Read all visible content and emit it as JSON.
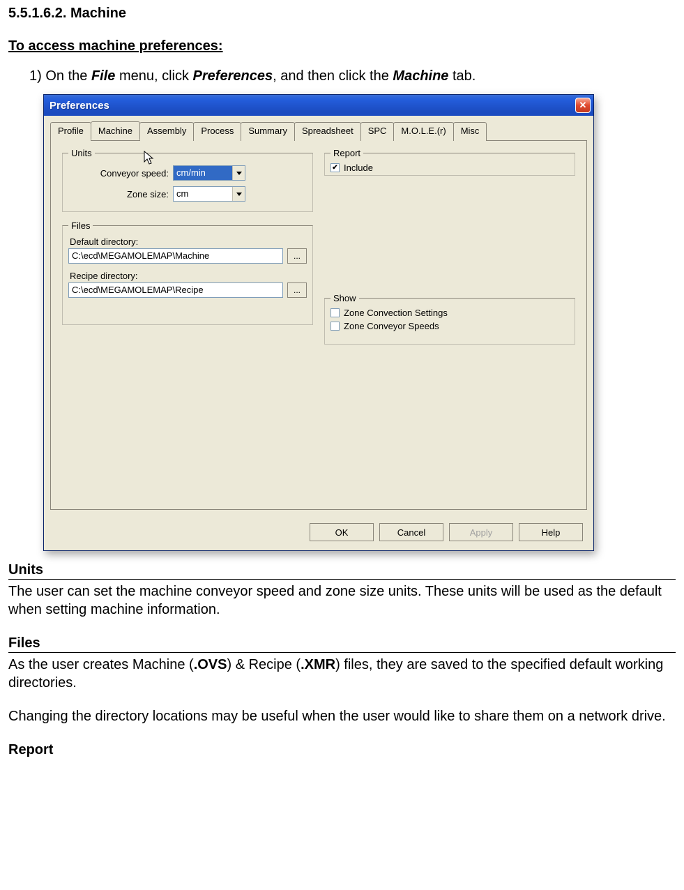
{
  "doc": {
    "section_number": "5.5.1.6.2. Machine",
    "access_heading": "To access machine preferences:",
    "step1_prefix": "1) On the ",
    "step1_kw_file": "File",
    "step1_mid1": " menu, click ",
    "step1_kw_prefs": "Preferences",
    "step1_mid2": ", and then click the ",
    "step1_kw_machine": "Machine",
    "step1_suffix": " tab.",
    "sections": {
      "units_head": "Units",
      "units_para": "The user can set the machine conveyor speed and zone size units. These units will be used as the default when setting machine information.",
      "files_head": "Files",
      "files_para1_a": "As the user creates Machine (",
      "files_para1_ovs": ".OVS",
      "files_para1_b": ") & Recipe (",
      "files_para1_xmr": ".XMR",
      "files_para1_c": ") files, they are saved to the specified default working directories.",
      "files_para2": "Changing the directory locations may be useful when the user would like to share them on a network drive.",
      "report_head": "Report"
    }
  },
  "dialog": {
    "title": "Preferences",
    "tabs": [
      "Profile",
      "Machine",
      "Assembly",
      "Process",
      "Summary",
      "Spreadsheet",
      "SPC",
      "M.O.L.E.(r)",
      "Misc"
    ],
    "active_tab_index": 1,
    "units": {
      "legend": "Units",
      "conveyor_label": "Conveyor speed:",
      "conveyor_value": "cm/min",
      "zone_label": "Zone size:",
      "zone_value": "cm"
    },
    "files": {
      "legend": "Files",
      "default_label": "Default directory:",
      "default_value": "C:\\ecd\\MEGAMOLEMAP\\Machine",
      "recipe_label": "Recipe directory:",
      "recipe_value": "C:\\ecd\\MEGAMOLEMAP\\Recipe",
      "browse_glyph": "..."
    },
    "report": {
      "legend": "Report",
      "include_label": "Include",
      "include_checked": true
    },
    "show": {
      "legend": "Show",
      "opt1": "Zone Convection Settings",
      "opt2": "Zone Conveyor Speeds"
    },
    "buttons": {
      "ok": "OK",
      "cancel": "Cancel",
      "apply": "Apply",
      "help": "Help"
    }
  }
}
